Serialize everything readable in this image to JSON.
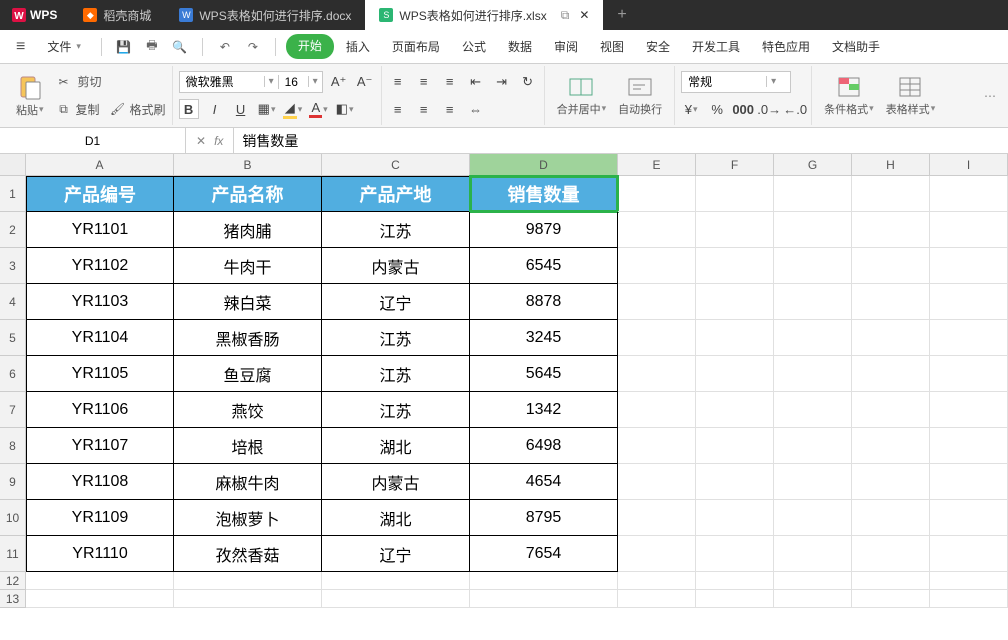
{
  "appbar": {
    "wps": "WPS",
    "tabs": [
      {
        "label": "稻壳商城",
        "icon_color": "orange"
      },
      {
        "label": "WPS表格如何进行排序.docx",
        "icon_color": "blue"
      },
      {
        "label": "WPS表格如何进行排序.xlsx",
        "icon_color": "green",
        "active": true
      }
    ],
    "plus": "+"
  },
  "menu": {
    "file": "文件",
    "tabs": [
      "开始",
      "插入",
      "页面布局",
      "公式",
      "数据",
      "审阅",
      "视图",
      "安全",
      "开发工具",
      "特色应用",
      "文档助手"
    ],
    "active": "开始"
  },
  "ribbon": {
    "paste": "粘贴",
    "cut": "剪切",
    "copy": "复制",
    "format_painter": "格式刷",
    "font_name": "微软雅黑",
    "font_size": "16",
    "aplus": "A⁺",
    "aminus": "A⁻",
    "bold": "B",
    "italic": "I",
    "underline": "U",
    "merge": "合并居中",
    "wrap": "自动换行",
    "num_format": "常规",
    "cond_fmt": "条件格式",
    "table_style": "表格样式"
  },
  "fxbar": {
    "cell_ref": "D1",
    "cancel": "✕",
    "fx": "fx",
    "formula": "销售数量"
  },
  "grid": {
    "cols": [
      "A",
      "B",
      "C",
      "D",
      "E",
      "F",
      "G",
      "H",
      "I"
    ],
    "selected_col": "D",
    "header_row": [
      "产品编号",
      "产品名称",
      "产品产地",
      "销售数量"
    ],
    "rows": [
      [
        "YR1101",
        "猪肉脯",
        "江苏",
        "9879"
      ],
      [
        "YR1102",
        "牛肉干",
        "内蒙古",
        "6545"
      ],
      [
        "YR1103",
        "辣白菜",
        "辽宁",
        "8878"
      ],
      [
        "YR1104",
        "黑椒香肠",
        "江苏",
        "3245"
      ],
      [
        "YR1105",
        "鱼豆腐",
        "江苏",
        "5645"
      ],
      [
        "YR1106",
        "燕饺",
        "江苏",
        "1342"
      ],
      [
        "YR1107",
        "培根",
        "湖北",
        "6498"
      ],
      [
        "YR1108",
        "麻椒牛肉",
        "内蒙古",
        "4654"
      ],
      [
        "YR1109",
        "泡椒萝卜",
        "湖北",
        "8795"
      ],
      [
        "YR1110",
        "孜然香菇",
        "辽宁",
        "7654"
      ]
    ],
    "selected_cell": {
      "r": 0,
      "c": 3
    }
  },
  "chart_data": {
    "type": "table",
    "title": "WPS表格如何进行排序",
    "columns": [
      "产品编号",
      "产品名称",
      "产品产地",
      "销售数量"
    ],
    "rows": [
      [
        "YR1101",
        "猪肉脯",
        "江苏",
        9879
      ],
      [
        "YR1102",
        "牛肉干",
        "内蒙古",
        6545
      ],
      [
        "YR1103",
        "辣白菜",
        "辽宁",
        8878
      ],
      [
        "YR1104",
        "黑椒香肠",
        "江苏",
        3245
      ],
      [
        "YR1105",
        "鱼豆腐",
        "江苏",
        5645
      ],
      [
        "YR1106",
        "燕饺",
        "江苏",
        1342
      ],
      [
        "YR1107",
        "培根",
        "湖北",
        6498
      ],
      [
        "YR1108",
        "麻椒牛肉",
        "内蒙古",
        4654
      ],
      [
        "YR1109",
        "泡椒萝卜",
        "湖北",
        8795
      ],
      [
        "YR1110",
        "孜然香菇",
        "辽宁",
        7654
      ]
    ]
  }
}
